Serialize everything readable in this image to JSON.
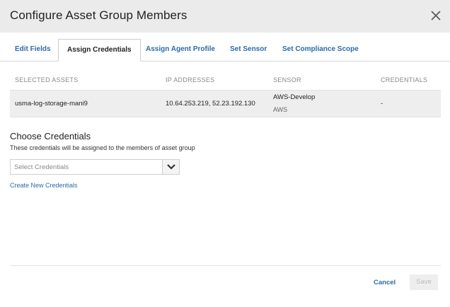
{
  "dialog": {
    "title": "Configure Asset Group Members",
    "close_icon": "close-icon"
  },
  "tabs": [
    {
      "label": "Edit Fields",
      "active": false
    },
    {
      "label": "Assign Credentials",
      "active": true
    },
    {
      "label": "Assign Agent Profile",
      "active": false
    },
    {
      "label": "Set Sensor",
      "active": false
    },
    {
      "label": "Set Compliance Scope",
      "active": false
    }
  ],
  "table": {
    "columns": [
      "SELECTED ASSETS",
      "IP ADDRESSES",
      "SENSOR",
      "CREDENTIALS"
    ],
    "rows": [
      {
        "asset": "usma-log-storage-mani9",
        "ip": "10.64.253.219, 52.23.192.130",
        "sensor_name": "AWS-Develop",
        "sensor_type": "AWS",
        "credentials": "-"
      }
    ]
  },
  "credentials": {
    "heading": "Choose Credentials",
    "description": "These credentials will be assigned to the members of asset group",
    "select_placeholder": "Select Credentials",
    "select_icon": "chevron-down-icon",
    "create_link": "Create New Credentials"
  },
  "footer": {
    "cancel_label": "Cancel",
    "save_label": "Save",
    "save_enabled": false
  },
  "colors": {
    "link": "#2c6aa8",
    "header_bg": "#ebebeb",
    "row_bg": "#eeeeee"
  }
}
